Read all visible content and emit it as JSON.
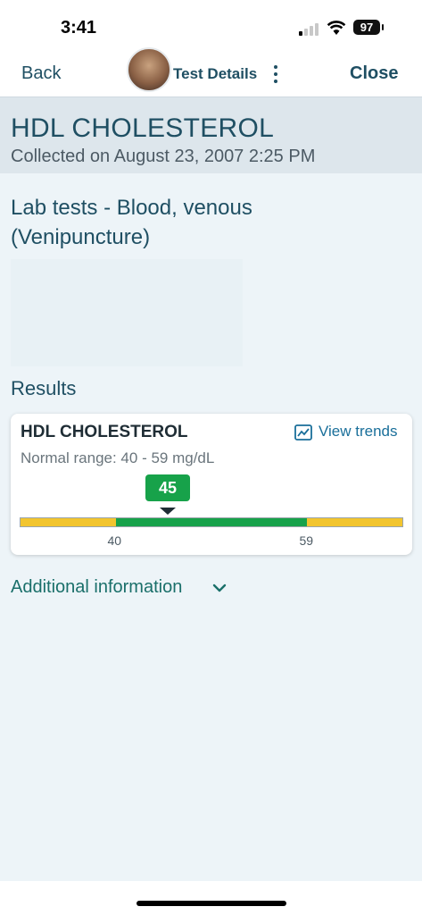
{
  "status_bar": {
    "time": "3:41",
    "battery": "97"
  },
  "nav": {
    "back_label": "Back",
    "title": "Test Details",
    "close_label": "Close"
  },
  "header": {
    "test_name": "HDL CHOLESTEROL",
    "collected": "Collected on August 23, 2007 2:25 PM"
  },
  "lab": {
    "title": "Lab tests - Blood, venous (Venipuncture)"
  },
  "results": {
    "section_label": "Results",
    "card": {
      "title": "HDL CHOLESTEROL",
      "view_trends": "View trends",
      "normal_range": "Normal range: 40 - 59 mg/dL",
      "value": "45",
      "range_low": "40",
      "range_high": "59",
      "value_fraction": 0.386,
      "normal_start_fraction": 0.25,
      "normal_end_fraction": 0.75
    }
  },
  "additional": {
    "label": "Additional information"
  },
  "colors": {
    "normal": "#17a24a",
    "out_of_range": "#f2c52f",
    "brand": "#1f4f63",
    "link": "#1a6f9a"
  },
  "icons": [
    "avatar",
    "kebab-menu-icon",
    "trend-chart-icon",
    "chevron-down-icon"
  ]
}
